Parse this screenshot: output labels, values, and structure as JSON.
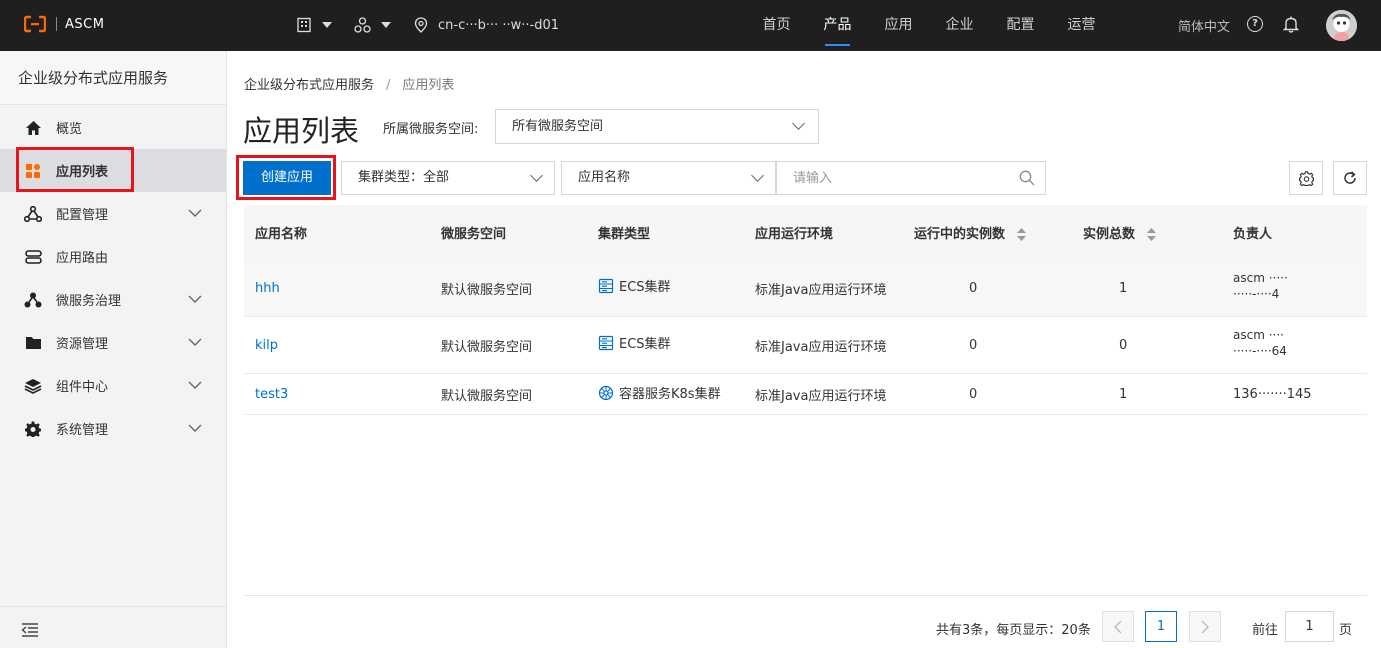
{
  "topbar": {
    "logo_text": "ASCM",
    "region": "cn-c···b··· ··w··-d01",
    "nav": [
      "首页",
      "产品",
      "应用",
      "企业",
      "配置",
      "运营"
    ],
    "active_nav_index": 1,
    "language": "简体中文",
    "accent_color": "#2f8cff"
  },
  "sidebar": {
    "title": "企业级分布式应用服务",
    "items": [
      {
        "label": "概览",
        "icon": "home-icon",
        "expandable": false
      },
      {
        "label": "应用列表",
        "icon": "app-grid-icon",
        "expandable": false,
        "active": true
      },
      {
        "label": "配置管理",
        "icon": "config-nodes-icon",
        "expandable": true
      },
      {
        "label": "应用路由",
        "icon": "route-icon",
        "expandable": false
      },
      {
        "label": "微服务治理",
        "icon": "microservice-icon",
        "expandable": true
      },
      {
        "label": "资源管理",
        "icon": "folder-icon",
        "expandable": true
      },
      {
        "label": "组件中心",
        "icon": "layers-icon",
        "expandable": true
      },
      {
        "label": "系统管理",
        "icon": "gear-icon",
        "expandable": true
      }
    ]
  },
  "breadcrumb": {
    "root": "企业级分布式应用服务",
    "separator": "/",
    "current": "应用列表"
  },
  "page": {
    "title": "应用列表",
    "namespace_label": "所属微服务空间:",
    "namespace_value": "所有微服务空间"
  },
  "toolbar": {
    "create_label": "创建应用",
    "cluster_filter": "集群类型：全部",
    "field_filter": "应用名称",
    "search_placeholder": "请输入"
  },
  "table": {
    "headers": [
      "应用名称",
      "微服务空间",
      "集群类型",
      "应用运行环境",
      "运行中的实例数",
      "实例总数",
      "负责人"
    ],
    "rows": [
      {
        "name": "hhh",
        "namespace": "默认微服务空间",
        "cluster": "ECS集群",
        "cluster_icon": "server-icon",
        "runtime": "标准Java应用运行环境",
        "running": "0",
        "total": "1",
        "owner_line1": "ascm ·····",
        "owner_line2": "·····-····4"
      },
      {
        "name": "kilp",
        "namespace": "默认微服务空间",
        "cluster": "ECS集群",
        "cluster_icon": "server-icon",
        "runtime": "标准Java应用运行环境",
        "running": "0",
        "total": "0",
        "owner_line1": "ascm ····",
        "owner_line2": "·····-····64"
      },
      {
        "name": "test3",
        "namespace": "默认微服务空间",
        "cluster": "容器服务K8s集群",
        "cluster_icon": "kubernetes-icon",
        "runtime": "标准Java应用运行环境",
        "running": "0",
        "total": "1",
        "owner_line1": "136·······145",
        "owner_line2": ""
      }
    ]
  },
  "pagination": {
    "summary": "共有3条，每页显示：20条",
    "current_page": "1",
    "goto_label": "前往",
    "goto_value": "1",
    "goto_suffix": "页"
  },
  "colors": {
    "primary": "#0070cc",
    "highlight_box": "#e8141a",
    "topbar_bg": "#1f1f1f"
  }
}
